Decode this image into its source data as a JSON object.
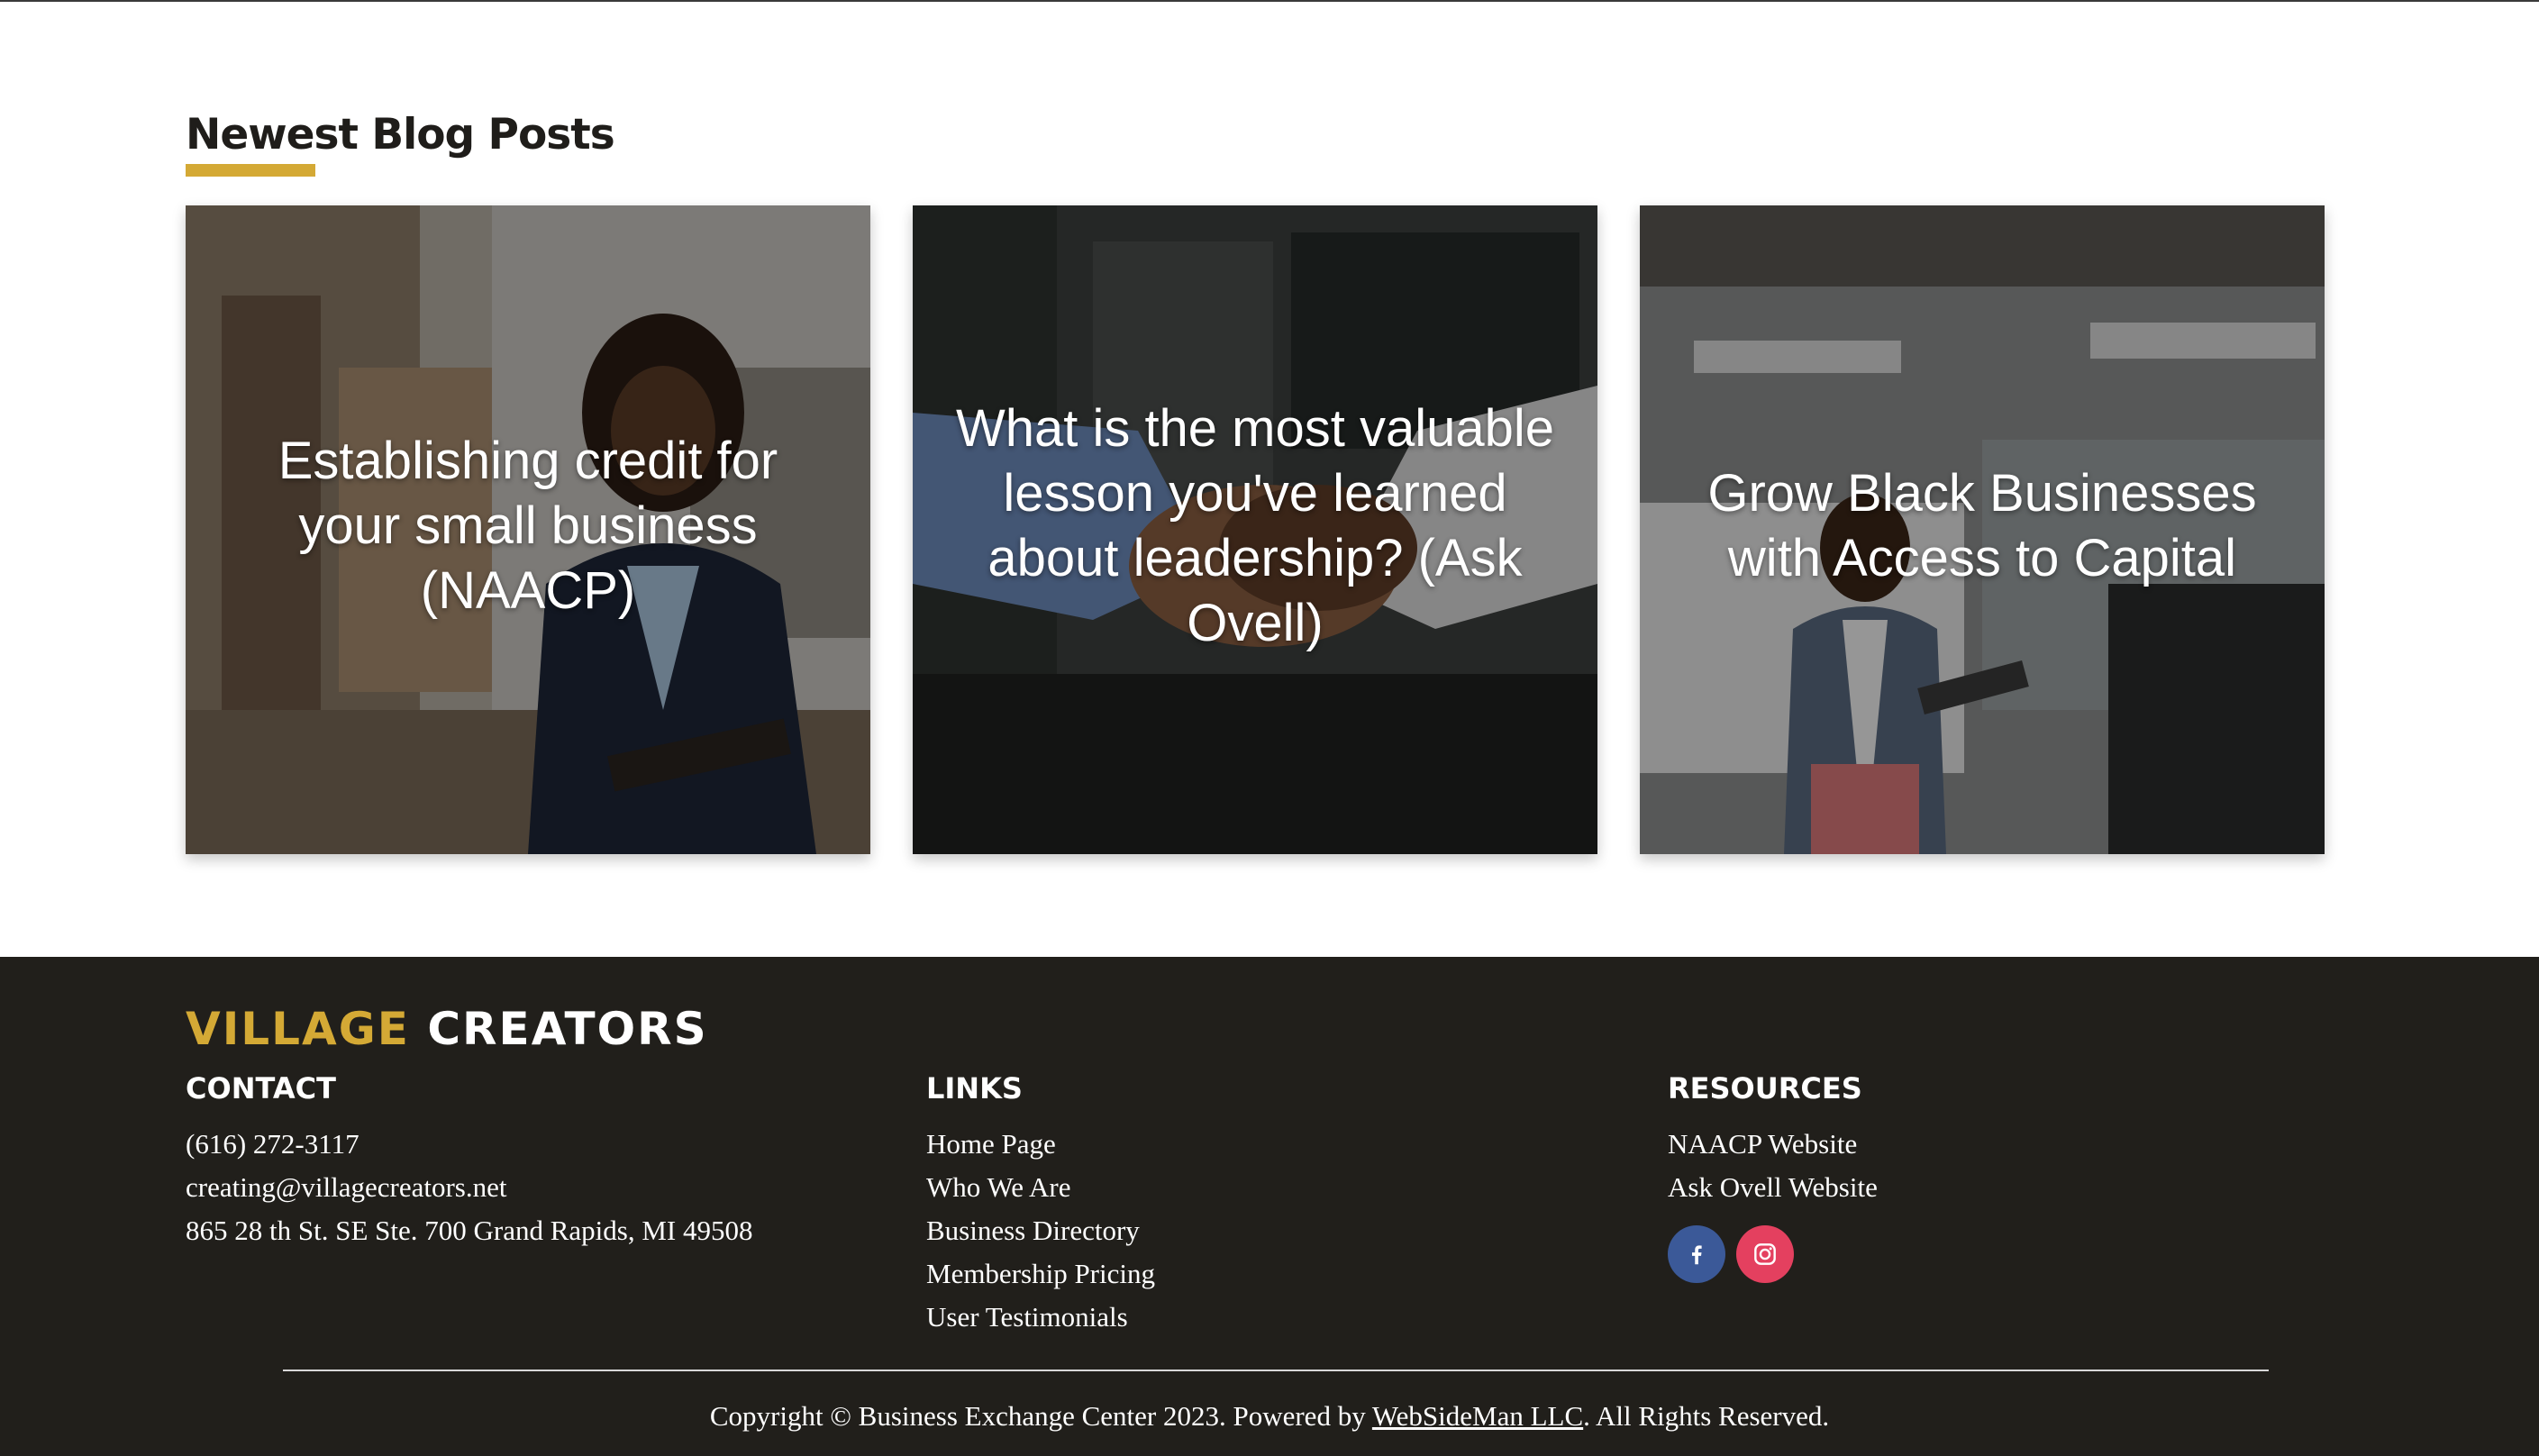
{
  "blog": {
    "heading": "Newest Blog Posts",
    "posts": [
      {
        "title": "Establishing credit for your small business (NAACP)"
      },
      {
        "title": "What is the most valuable lesson you've learned about leadership? (Ask Ovell)"
      },
      {
        "title": "Grow Black Businesses with Access to Capital"
      }
    ]
  },
  "footer": {
    "brand": {
      "part1": "VILLAGE",
      "part2": "CREATORS"
    },
    "contact": {
      "heading": "CONTACT",
      "phone": "(616) 272-3117",
      "email": "creating@villagecreators.net",
      "address": "865 28 th St. SE Ste. 700 Grand Rapids, MI 49508"
    },
    "links": {
      "heading": "LINKS",
      "items": [
        "Home Page",
        "Who We Are",
        "Business Directory",
        "Membership Pricing",
        "User Testimonials"
      ]
    },
    "resources": {
      "heading": "RESOURCES",
      "items": [
        "NAACP Website",
        "Ask Ovell Website"
      ],
      "social": [
        "facebook-icon",
        "instagram-icon"
      ]
    },
    "copyright": {
      "before": "Copyright © Business Exchange Center 2023. Powered by ",
      "link": "WebSideMan LLC",
      "after": ". All Rights Reserved."
    }
  },
  "colors": {
    "accent": "#d4a935",
    "footer_bg": "#211f1b",
    "facebook": "#3b5998",
    "instagram": "#e4405f"
  }
}
